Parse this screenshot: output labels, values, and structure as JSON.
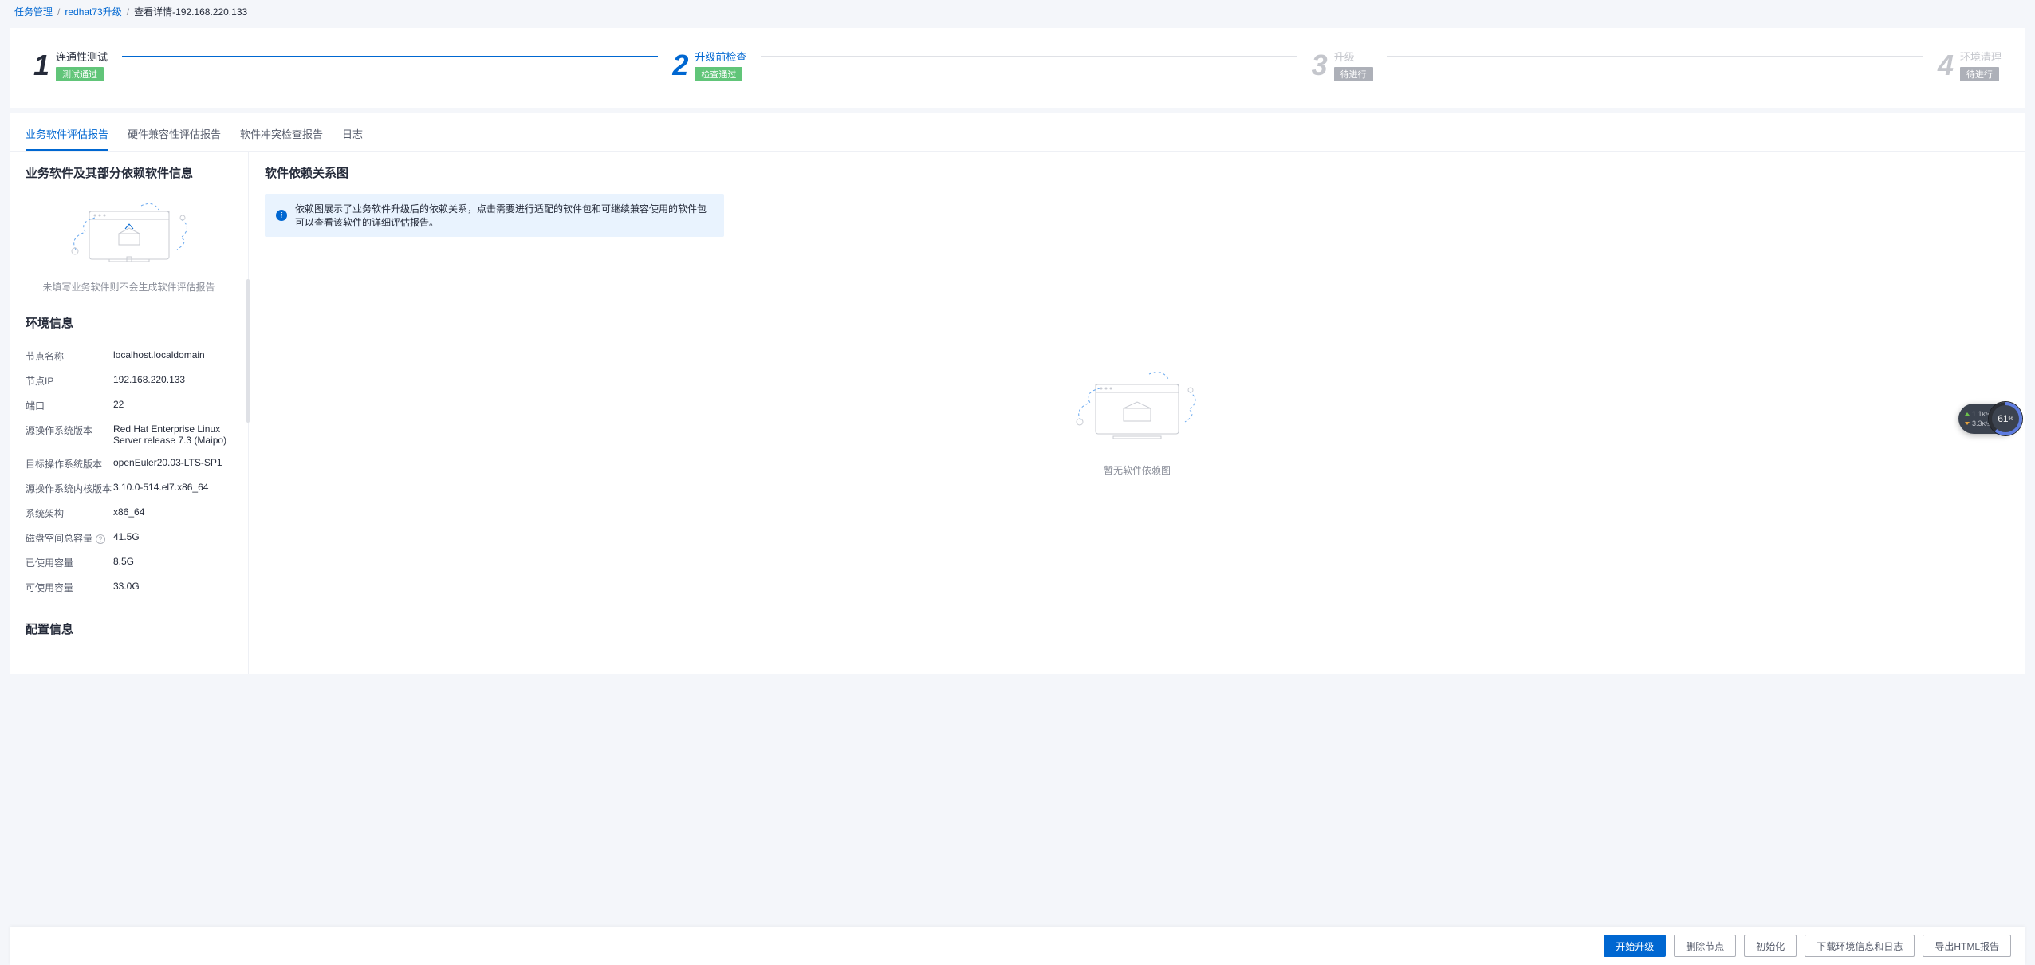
{
  "breadcrumb": {
    "items": [
      "任务管理",
      "redhat73升级"
    ],
    "current": "查看详情-192.168.220.133"
  },
  "steps": [
    {
      "num": "1",
      "title": "连通性测试",
      "badge": "测试通过",
      "badgeClass": "badge-green",
      "state": "done"
    },
    {
      "num": "2",
      "title": "升级前检查",
      "badge": "检查通过",
      "badgeClass": "badge-green",
      "state": "active"
    },
    {
      "num": "3",
      "title": "升级",
      "badge": "待进行",
      "badgeClass": "badge-gray",
      "state": "pending"
    },
    {
      "num": "4",
      "title": "环境清理",
      "badge": "待进行",
      "badgeClass": "badge-gray",
      "state": "pending"
    }
  ],
  "tabs": [
    "业务软件评估报告",
    "硬件兼容性评估报告",
    "软件冲突检查报告",
    "日志"
  ],
  "activeTab": 0,
  "side": {
    "section1Title": "业务软件及其部分依赖软件信息",
    "emptyCaption": "未填写业务软件则不会生成软件评估报告",
    "envTitle": "环境信息",
    "fields": [
      {
        "k": "节点名称",
        "v": "localhost.localdomain"
      },
      {
        "k": "节点IP",
        "v": "192.168.220.133"
      },
      {
        "k": "端口",
        "v": "22"
      },
      {
        "k": "源操作系统版本",
        "v": "Red Hat Enterprise Linux Server release 7.3 (Maipo)"
      },
      {
        "k": "目标操作系统版本",
        "v": "openEuler20.03-LTS-SP1"
      },
      {
        "k": "源操作系统内核版本",
        "v": "3.10.0-514.el7.x86_64"
      },
      {
        "k": "系统架构",
        "v": "x86_64"
      },
      {
        "k": "磁盘空间总容量",
        "v": "41.5G",
        "help": true
      },
      {
        "k": "已使用容量",
        "v": "8.5G"
      },
      {
        "k": "可使用容量",
        "v": "33.0G"
      }
    ],
    "cfgTitle": "配置信息"
  },
  "main": {
    "heading": "软件依赖关系图",
    "alert": "依赖图展示了业务软件升级后的依赖关系，点击需要进行适配的软件包和可继续兼容使用的软件包可以查看该软件的详细评估报告。",
    "emptyCaption": "暂无软件依赖图"
  },
  "actions": {
    "primary": "开始升级",
    "secondary": [
      "删除节点",
      "初始化",
      "下载环境信息和日志",
      "导出HTML报告"
    ]
  },
  "perf": {
    "up": "1.1",
    "upUnit": "K/s",
    "down": "3.3",
    "downUnit": "K/s",
    "ring": "61",
    "ringUnit": "%"
  }
}
